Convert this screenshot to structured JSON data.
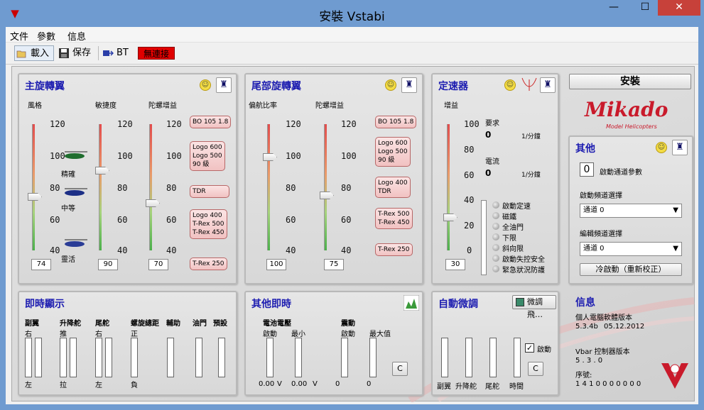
{
  "window": {
    "title": "安裝 Vstabi",
    "min": "—",
    "max": "☐",
    "close": "✕"
  },
  "menu": [
    "文件",
    "參數",
    "信息"
  ],
  "toolbar": {
    "load": "載入",
    "save": "保存",
    "bt": "BT",
    "status": "無連接"
  },
  "main_rotor": {
    "title": "主旋轉翼",
    "style_label": "風格",
    "agility_label": "敏捷度",
    "gyro_label": "陀螺增益",
    "ticks": [
      "120",
      "100",
      "80",
      "60",
      "40"
    ],
    "style_modes": [
      "精確",
      "中等",
      "靈活"
    ],
    "style_value": "74",
    "agility_value": "90",
    "gyro_value": "70",
    "presets": [
      "BO 105 1.8",
      "Logo 600\nLogo 500\n90 級",
      "TDR",
      "Logo 400\nT-Rex 500\nT-Rex 450",
      "T-Rex 250"
    ]
  },
  "tail_rotor": {
    "title": "尾部旋轉翼",
    "yaw_label": "偏航比率",
    "gyro_label": "陀螺增益",
    "ticks": [
      "120",
      "100",
      "80",
      "60",
      "40"
    ],
    "yaw_value": "100",
    "gyro_value": "75",
    "presets": [
      "BO 105 1.8",
      "Logo 600\nLogo 500\n90 級",
      "Logo 400\nTDR",
      "T-Rex 500\nT-Rex 450",
      "T-Rex 250"
    ]
  },
  "governor": {
    "title": "定速器",
    "gain_label": "增益",
    "ticks": [
      "100",
      "80",
      "60",
      "40",
      "20",
      "0"
    ],
    "gain_value": "30",
    "request_label": "要求",
    "request_value": "0",
    "request_unit": "1/分鐘",
    "current_label": "電流",
    "current_value": "0",
    "current_unit": "1/分鐘",
    "options": [
      "啟動定速",
      "磁鐵",
      "全油門",
      "下限",
      "斜向限",
      "啟動失控安全",
      "緊急狀況防護"
    ]
  },
  "install": {
    "label": "安裝"
  },
  "logo": {
    "brand": "Mikado",
    "sub": "Model Helicopters"
  },
  "other": {
    "title": "其他",
    "channel_value": "0",
    "channel_label": "啟動通道參數",
    "startup_label": "啟動頻道選擇",
    "startup_value": "通道 0",
    "edit_label": "編輯頻道選擇",
    "edit_value": "通道 0",
    "cold_start": "冷啟動（重新校正）"
  },
  "realtime": {
    "title": "即時顯示",
    "cols": [
      {
        "name": "副翼",
        "top": "右",
        "bottom": "左"
      },
      {
        "name": "升降舵",
        "top": "推",
        "bottom": "拉"
      },
      {
        "name": "尾舵",
        "top": "右",
        "bottom": "左"
      },
      {
        "name": "螺旋總距",
        "top": "正",
        "bottom": "負"
      },
      {
        "name": "輔助",
        "top": "",
        "bottom": ""
      },
      {
        "name": "油門",
        "top": "",
        "bottom": ""
      },
      {
        "name": "預設",
        "top": "",
        "bottom": ""
      }
    ]
  },
  "other_rt": {
    "title": "其他即時",
    "battery_label": "電池電壓",
    "start_label": "啟動",
    "min_label": "最小",
    "vib_label": "震動",
    "vib_start": "啟動",
    "vib_max": "最大值",
    "v1": "0.00",
    "v2": "0.00",
    "unit": "V",
    "c1": "0",
    "c2": "0",
    "reset": "C"
  },
  "autotrim": {
    "title": "自動微調",
    "fly_btn": "微調飛…",
    "enable_label": "啟動",
    "reset": "C",
    "bars": [
      "副翼",
      "升降舵",
      "尾舵",
      "時間"
    ]
  },
  "info": {
    "title": "信息",
    "sw_label": "個人電腦軟體版本",
    "sw_version": "5.3.4b",
    "sw_date": "05.12.2012",
    "fw_label": "Vbar 控制器版本",
    "fw_version": "5 . 3 . 0",
    "serial_label": "序號:",
    "serial_value": "1 4 1 0 0 0 0 0 0 0"
  },
  "colors": {
    "title": "#1c1cb0",
    "status": "#e00000",
    "accent": "#c91a2b"
  }
}
